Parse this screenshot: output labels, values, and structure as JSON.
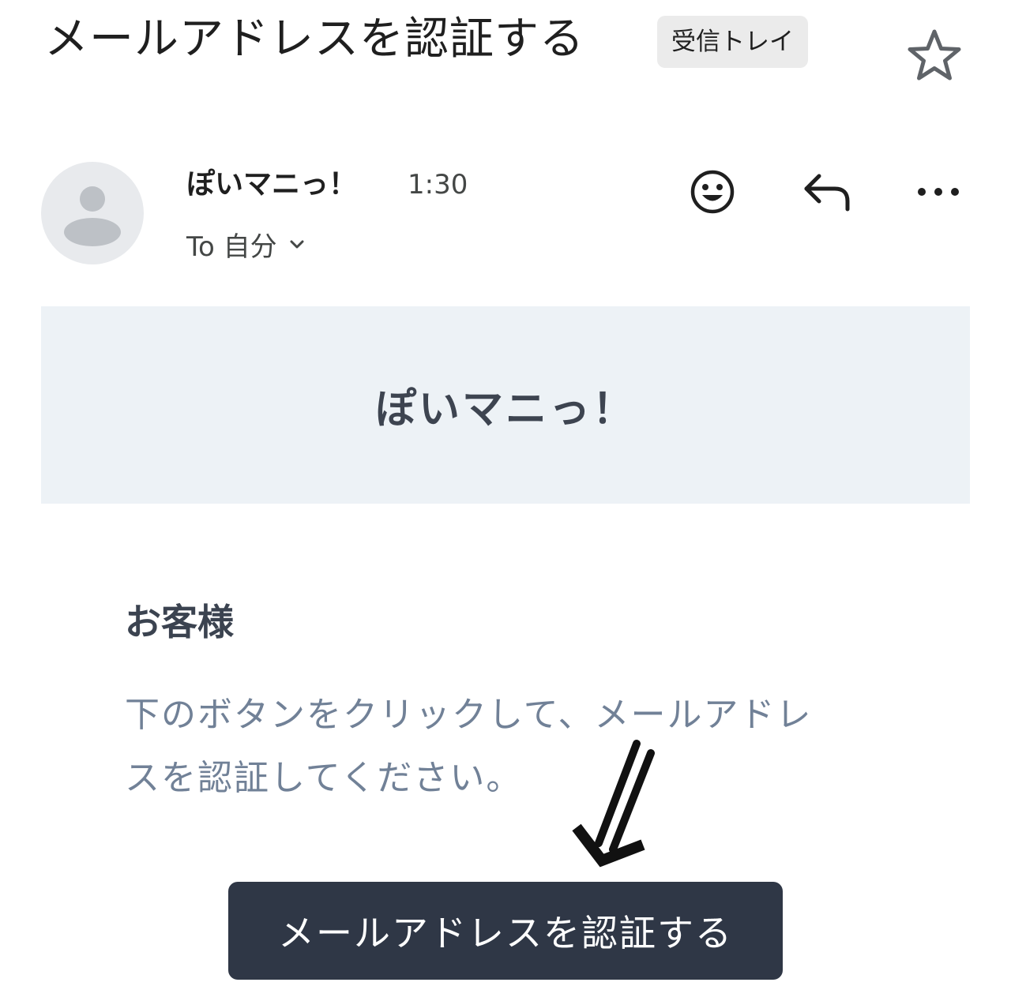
{
  "email": {
    "subject": "メールアドレスを認証する",
    "label": "受信トレイ",
    "sender": {
      "name": "ぽいマニっ！",
      "time": "1:30",
      "recipient": "To 自分"
    },
    "actions": {
      "emoji": "emoji-reaction-icon",
      "reply": "reply-icon",
      "more": "more-options-icon"
    }
  },
  "body": {
    "banner_title": "ぽいマニっ！",
    "greeting": "お客様",
    "message_line1": "下のボタンをクリックして、メールアドレ",
    "message_line2": "スを認証してください。",
    "verify_button": "メールアドレスを認証する"
  },
  "colors": {
    "banner_bg": "#edf2f6",
    "button_bg": "#2f3746",
    "body_text": "#718197",
    "chip_bg": "#ebebeb"
  }
}
